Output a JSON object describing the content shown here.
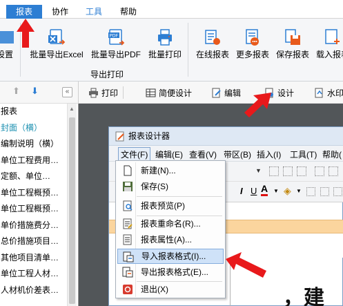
{
  "menu_tabs": [
    {
      "label": "报表",
      "active": true
    },
    {
      "label": "协作",
      "active": false
    },
    {
      "label": "工具",
      "active": false
    },
    {
      "label": "帮助",
      "active": false
    }
  ],
  "ribbon": {
    "items": [
      {
        "label": "设置",
        "icon": "settings-icon"
      },
      {
        "label": "批量导出Excel",
        "icon": "excel-export-icon"
      },
      {
        "label": "批量导出PDF",
        "icon": "pdf-export-icon"
      },
      {
        "label": "批量打印",
        "icon": "printer-icon"
      },
      {
        "label": "在线报表",
        "icon": "online-report-icon"
      },
      {
        "label": "更多报表",
        "icon": "more-reports-icon"
      },
      {
        "label": "保存报表",
        "icon": "save-report-icon"
      },
      {
        "label": "载入报表",
        "icon": "load-report-icon"
      }
    ],
    "group_label": "导出打印"
  },
  "tree": {
    "items": [
      "报表",
      "封面（横）",
      "编制说明（横）",
      "单位工程费用…",
      "定额、单位…",
      "单位工程概预…",
      "单位工程概预…",
      "单价措施费分…",
      "总价措施项目…",
      "其他项目清单…",
      "单位工程人材…",
      "人材机价差表…"
    ],
    "selected_index": 1
  },
  "toolbar": {
    "print": "打印",
    "simple_design": "简便设计",
    "edit": "编辑",
    "design": "设计",
    "watermark": "水印"
  },
  "designer": {
    "title": "报表设计器",
    "menus": [
      "文件(F)",
      "编辑(E)",
      "查看(V)",
      "带区(B)",
      "插入(I)",
      "工具(T)",
      "帮助("
    ],
    "file_menu": [
      {
        "label": "新建(N)...",
        "icon": "new-file-icon"
      },
      {
        "label": "保存(S)",
        "icon": "save-icon"
      },
      {
        "label": "报表预览(P)",
        "icon": "preview-icon"
      },
      {
        "label": "报表重命名(R)...",
        "icon": "rename-icon"
      },
      {
        "label": "报表属性(A)...",
        "icon": "properties-icon"
      },
      {
        "label": "导入报表格式(I)...",
        "icon": "import-format-icon",
        "highlighted": true
      },
      {
        "label": "导出报表格式(E)...",
        "icon": "export-format-icon"
      },
      {
        "label": "退出(X)",
        "icon": "exit-icon"
      }
    ],
    "font_color_letter": "A",
    "canvas_text": "，建"
  },
  "colors": {
    "accent": "#2d7ed3",
    "annotation": "#e8191b",
    "highlight": "#cfe2f8",
    "band": "#fbd59e",
    "preview_bg": "#525659"
  }
}
